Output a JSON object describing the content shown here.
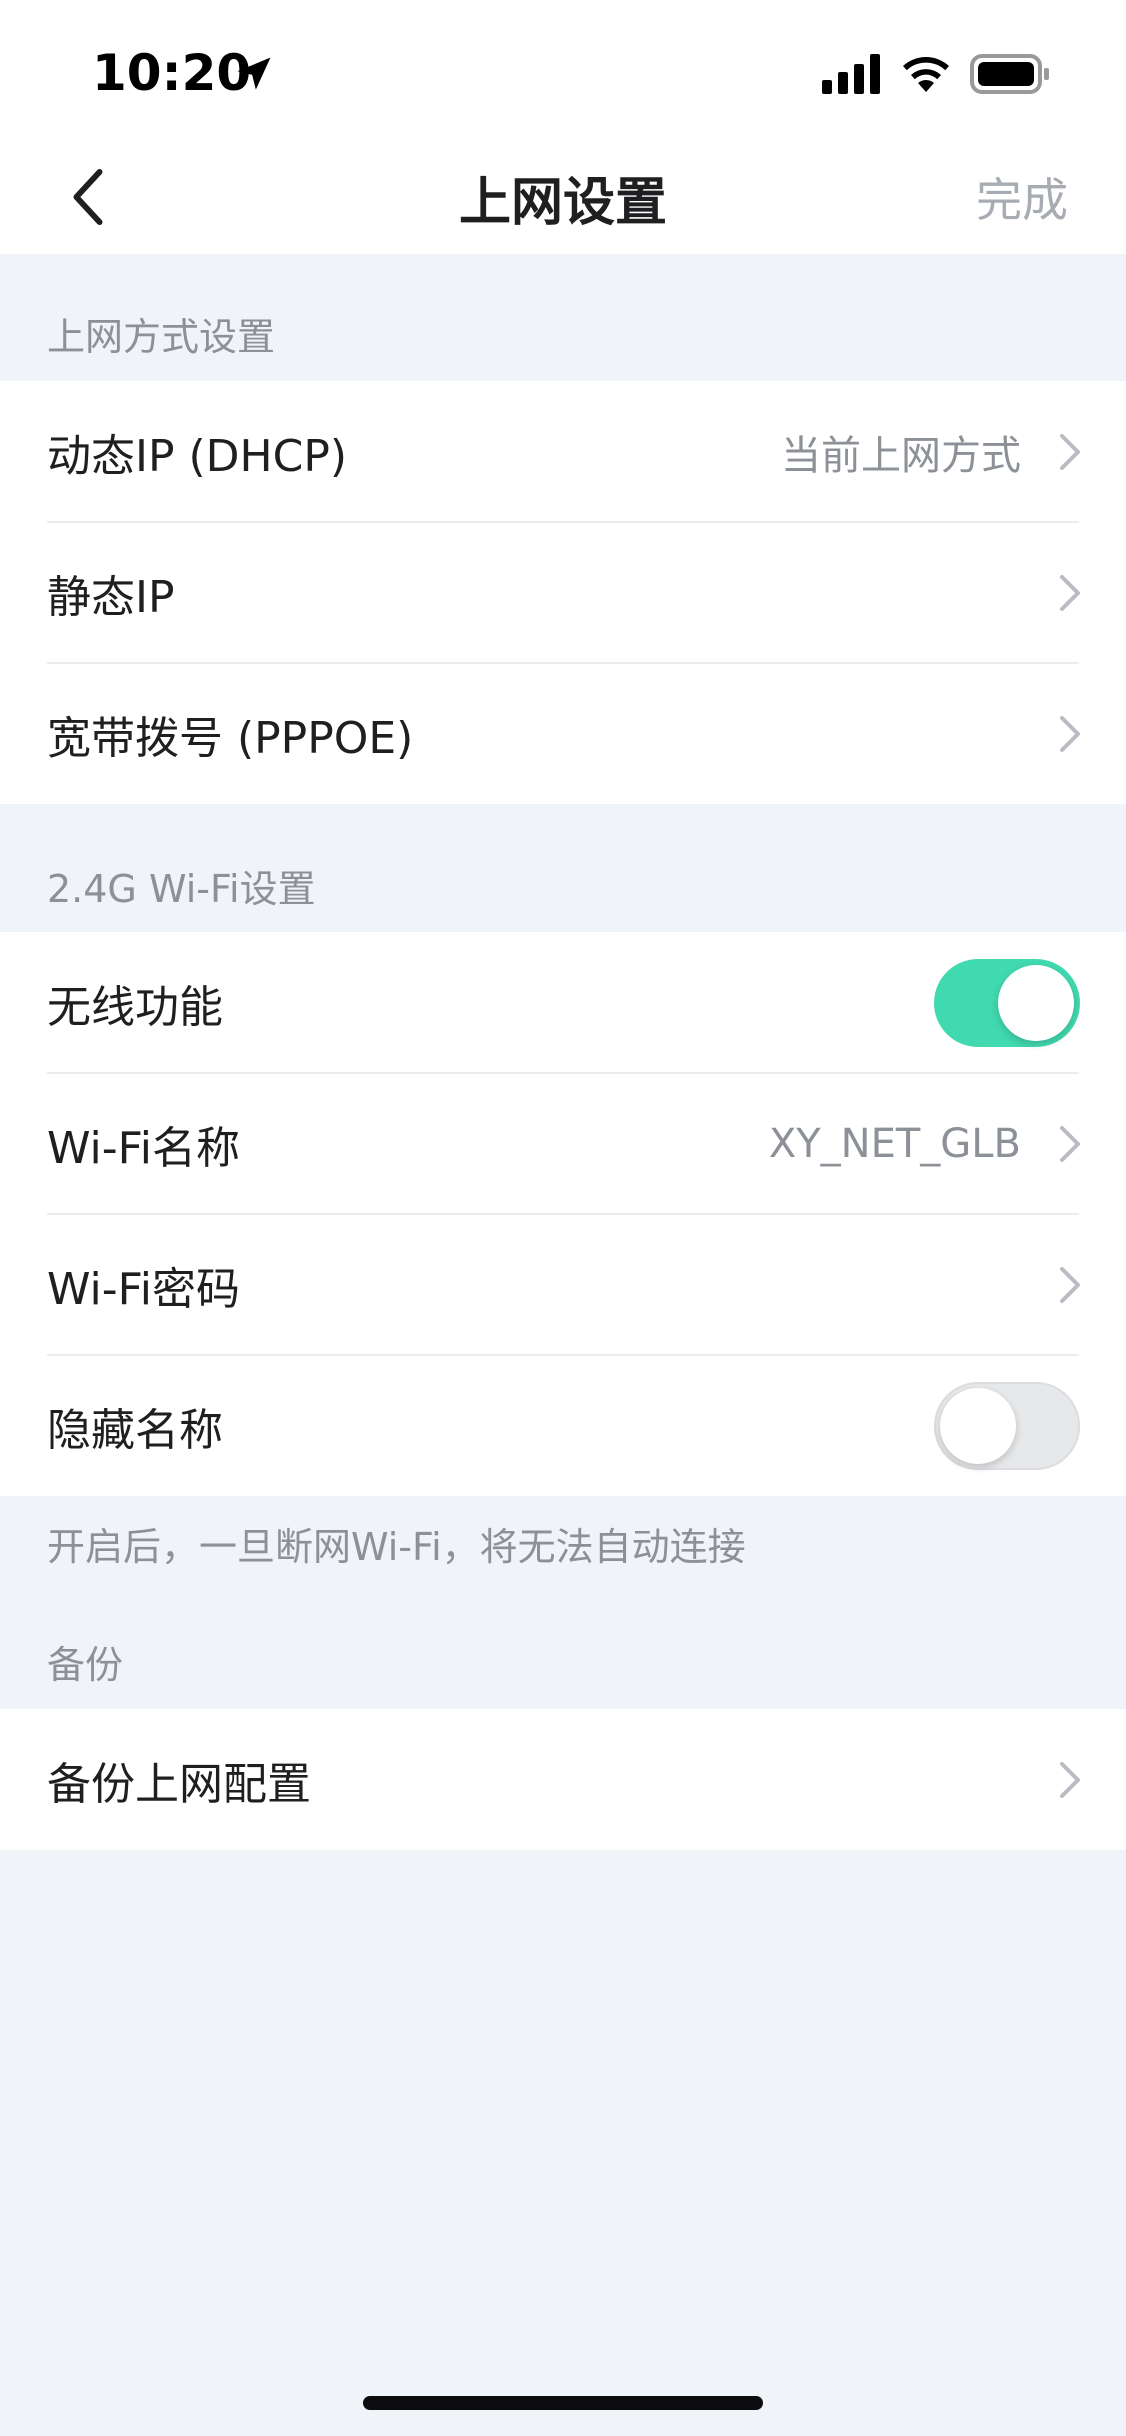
{
  "status_bar": {
    "time": "10:20",
    "icons": [
      "location-arrow-icon",
      "cellular-signal-icon",
      "wifi-icon",
      "battery-icon"
    ]
  },
  "nav": {
    "title": "上网设置",
    "back_icon": "chevron-left-icon",
    "done_label": "完成"
  },
  "sections": {
    "connection": {
      "header": "上网方式设置",
      "rows": [
        {
          "label": "动态IP (DHCP)",
          "value": "当前上网方式"
        },
        {
          "label": "静态IP",
          "value": ""
        },
        {
          "label": "宽带拨号 (PPPOE)",
          "value": ""
        }
      ]
    },
    "wifi24": {
      "header": "2.4G Wi-Fi设置",
      "wireless": {
        "label": "无线功能",
        "enabled": true
      },
      "name": {
        "label": "Wi-Fi名称",
        "value": "XY_NET_GLB"
      },
      "password": {
        "label": "Wi-Fi密码"
      },
      "hide_ssid": {
        "label": "隐藏名称",
        "enabled": false
      },
      "footnote": "开启后，一旦断网Wi-Fi，将无法自动连接"
    },
    "backup": {
      "header": "备份",
      "row": {
        "label": "备份上网配置"
      }
    }
  },
  "colors": {
    "accent": "#41d9b0",
    "background": "#f0f3f7",
    "secondary_text": "#8c9097",
    "done_disabled": "#a7acb3"
  }
}
